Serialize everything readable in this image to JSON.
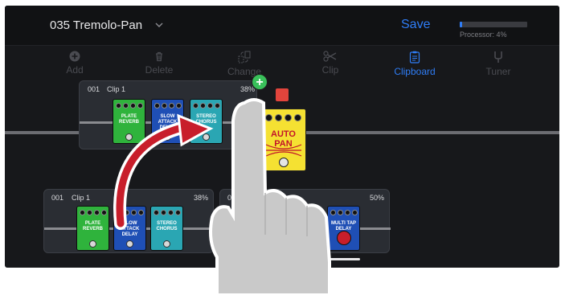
{
  "header": {
    "preset_name": "035 Tremolo-Pan",
    "save_label": "Save",
    "processor_label": "Processor: 4%",
    "processor_fraction": 0.04
  },
  "toolbar": {
    "items": [
      {
        "label": "Add",
        "icon": "add-icon"
      },
      {
        "label": "Delete",
        "icon": "trash-icon"
      },
      {
        "label": "Change",
        "icon": "change-icon"
      },
      {
        "label": "Clip",
        "icon": "scissors-icon"
      },
      {
        "label": "Clipboard",
        "icon": "clipboard-icon"
      },
      {
        "label": "Tuner",
        "icon": "tuner-fork-icon"
      }
    ]
  },
  "clips": {
    "floating": {
      "number": "001",
      "name": "Clip 1",
      "percent": "38%"
    },
    "bottom_left": {
      "number": "001",
      "name": "Clip 1",
      "percent": "38%"
    },
    "bottom_right": {
      "number": "0",
      "percent": "50%"
    }
  },
  "pedals": {
    "plate_reverb": "PLATE REVERB",
    "slow_attack_delay": "SLOW ATTACK DELAY",
    "stereo_chorus": "STEREO CHORUS",
    "auto_pan": "AUTO PAN",
    "multi_tap_delay": "MULTI TAP DELAY"
  },
  "colors": {
    "accent": "#2f7df6",
    "plate_reverb": "#2fb33c",
    "slow_attack_delay": "#1f4fb5",
    "stereo_chorus": "#2aa6b3",
    "auto_pan": "#f5e132",
    "multi_tap_delay": "#1f4fb5",
    "arrow": "#c81e2b",
    "add_badge": "#39c05a"
  }
}
